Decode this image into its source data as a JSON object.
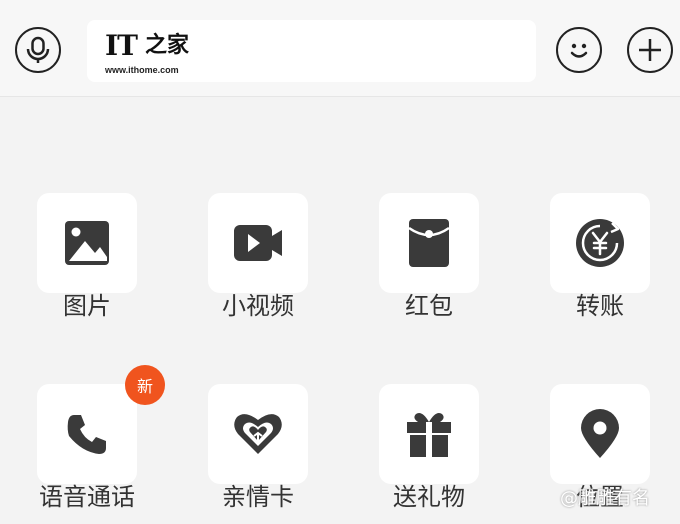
{
  "topbar": {
    "logo_it": "IT",
    "logo_han": "之家",
    "logo_url": "www.ithome.com",
    "icons": [
      "microphone-icon",
      "smiley-icon",
      "plus-icon"
    ]
  },
  "grid": {
    "items": [
      {
        "label": "图片",
        "icon": "image-icon"
      },
      {
        "label": "小视频",
        "icon": "video-camera-icon"
      },
      {
        "label": "红包",
        "icon": "red-packet-icon"
      },
      {
        "label": "转账",
        "icon": "yuan-transfer-icon"
      },
      {
        "label": "语音通话",
        "icon": "phone-icon",
        "badge": "新"
      },
      {
        "label": "亲情卡",
        "icon": "heart-card-icon"
      },
      {
        "label": "送礼物",
        "icon": "gift-icon"
      },
      {
        "label": "位置",
        "icon": "location-pin-icon"
      }
    ]
  },
  "watermark": "@雕雕有名",
  "colors": {
    "badge": "#f0541e",
    "icon": "#3a3a3a",
    "background": "#f3f3f3"
  }
}
